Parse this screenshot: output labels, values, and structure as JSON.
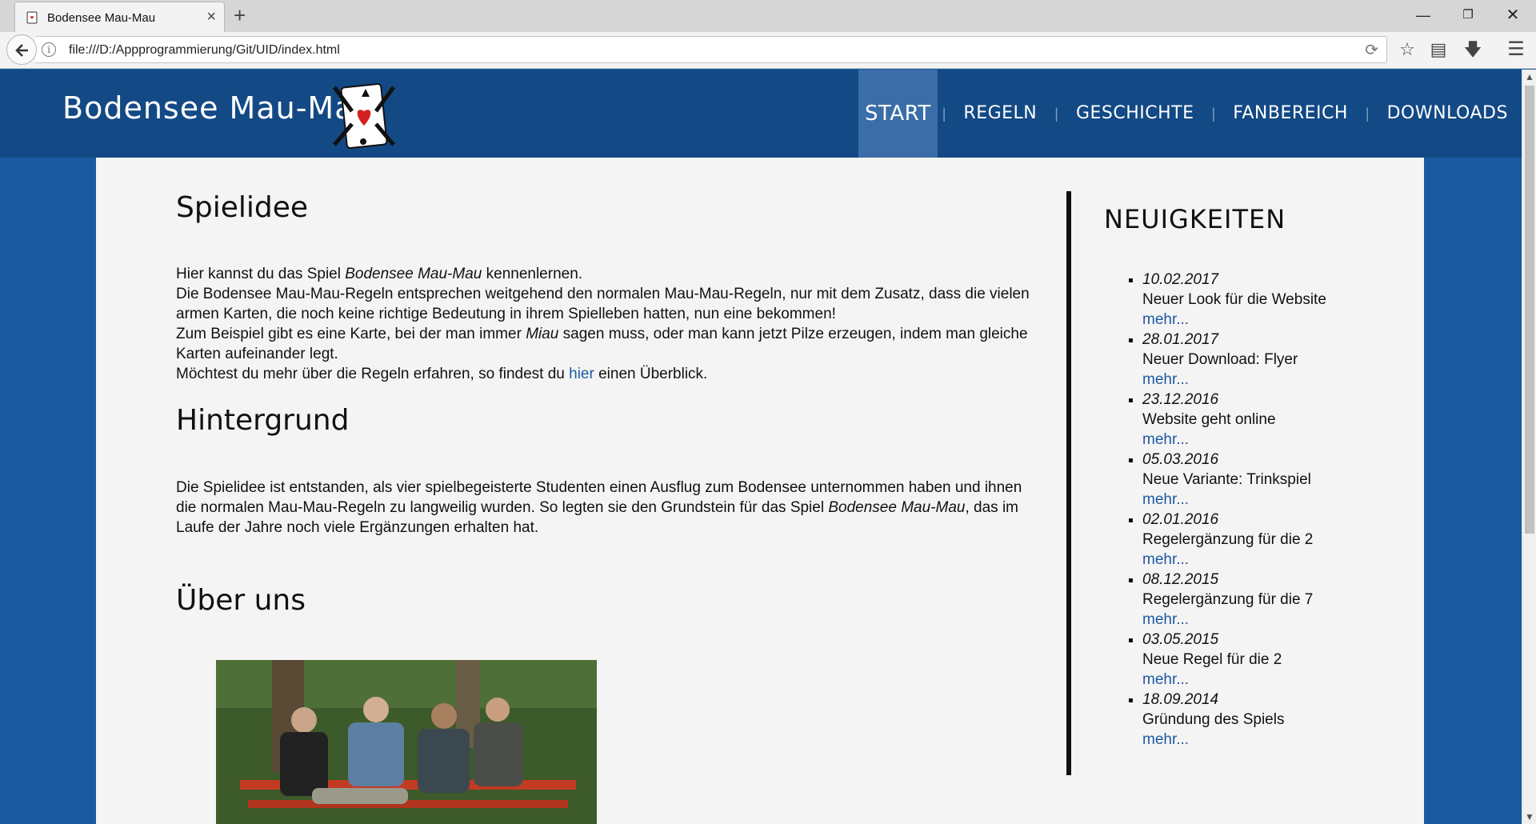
{
  "browser": {
    "tab_title": "Bodensee Mau-Mau",
    "url": "file:///D:/Appprogrammierung/Git/UID/index.html",
    "new_tab_label": "+",
    "close_tab_label": "×"
  },
  "header": {
    "logo_text": "Bodensee Mau-Mau",
    "nav": [
      "START",
      "REGELN",
      "GESCHICHTE",
      "FANBEREICH",
      "DOWNLOADS"
    ],
    "active_nav": "START"
  },
  "main": {
    "section1_title": "Spielidee",
    "section1_lines": {
      "l1_a": "Hier kannst du das Spiel ",
      "l1_em": "Bodensee Mau-Mau",
      "l1_b": " kennenlernen.",
      "l2": "Die Bodensee Mau-Mau-Regeln entsprechen weitgehend den normalen Mau-Mau-Regeln, nur mit dem Zusatz, dass die vielen armen Karten, die noch keine richtige Bedeutung in ihrem Spielleben hatten, nun eine bekommen!",
      "l3_a": "Zum Beispiel gibt es eine Karte, bei der man immer ",
      "l3_em": "Miau",
      "l3_b": " sagen muss, oder man kann jetzt Pilze erzeugen, indem man gleiche Karten aufeinander legt.",
      "l4_a": "Möchtest du mehr über die Regeln erfahren, so findest du ",
      "l4_link": "hier",
      "l4_b": " einen Überblick."
    },
    "section2_title": "Hintergrund",
    "section2": {
      "a": "Die Spielidee ist entstanden, als vier spielbegeisterte Studenten einen Ausflug zum Bodensee unternommen haben und ihnen die normalen Mau-Mau-Regeln zu langweilig wurden. So legten sie den Grundstein für das Spiel ",
      "em": "Bodensee Mau-Mau",
      "b": ", das im Laufe der Jahre noch viele Ergänzungen erhalten hat."
    },
    "section3_title": "Über uns"
  },
  "news": {
    "title": "NEUIGKEITEN",
    "more_label": "mehr...",
    "items": [
      {
        "date": "10.02.2017",
        "text": "Neuer Look für die Website"
      },
      {
        "date": "28.01.2017",
        "text": "Neuer Download: Flyer"
      },
      {
        "date": "23.12.2016",
        "text": "Website geht online"
      },
      {
        "date": "05.03.2016",
        "text": "Neue Variante: Trinkspiel"
      },
      {
        "date": "02.01.2016",
        "text": "Regelergänzung für die 2"
      },
      {
        "date": "08.12.2015",
        "text": "Regelergänzung für die 7"
      },
      {
        "date": "03.05.2015",
        "text": "Neue Regel für die 2"
      },
      {
        "date": "18.09.2014",
        "text": "Gründung des Spiels"
      }
    ]
  },
  "colors": {
    "header_bg": "#134985",
    "page_bg": "#1a5aa0",
    "nav_active_bg": "#3b6ea8",
    "link": "#1d5aa0",
    "content_bg": "#f4f4f4"
  }
}
